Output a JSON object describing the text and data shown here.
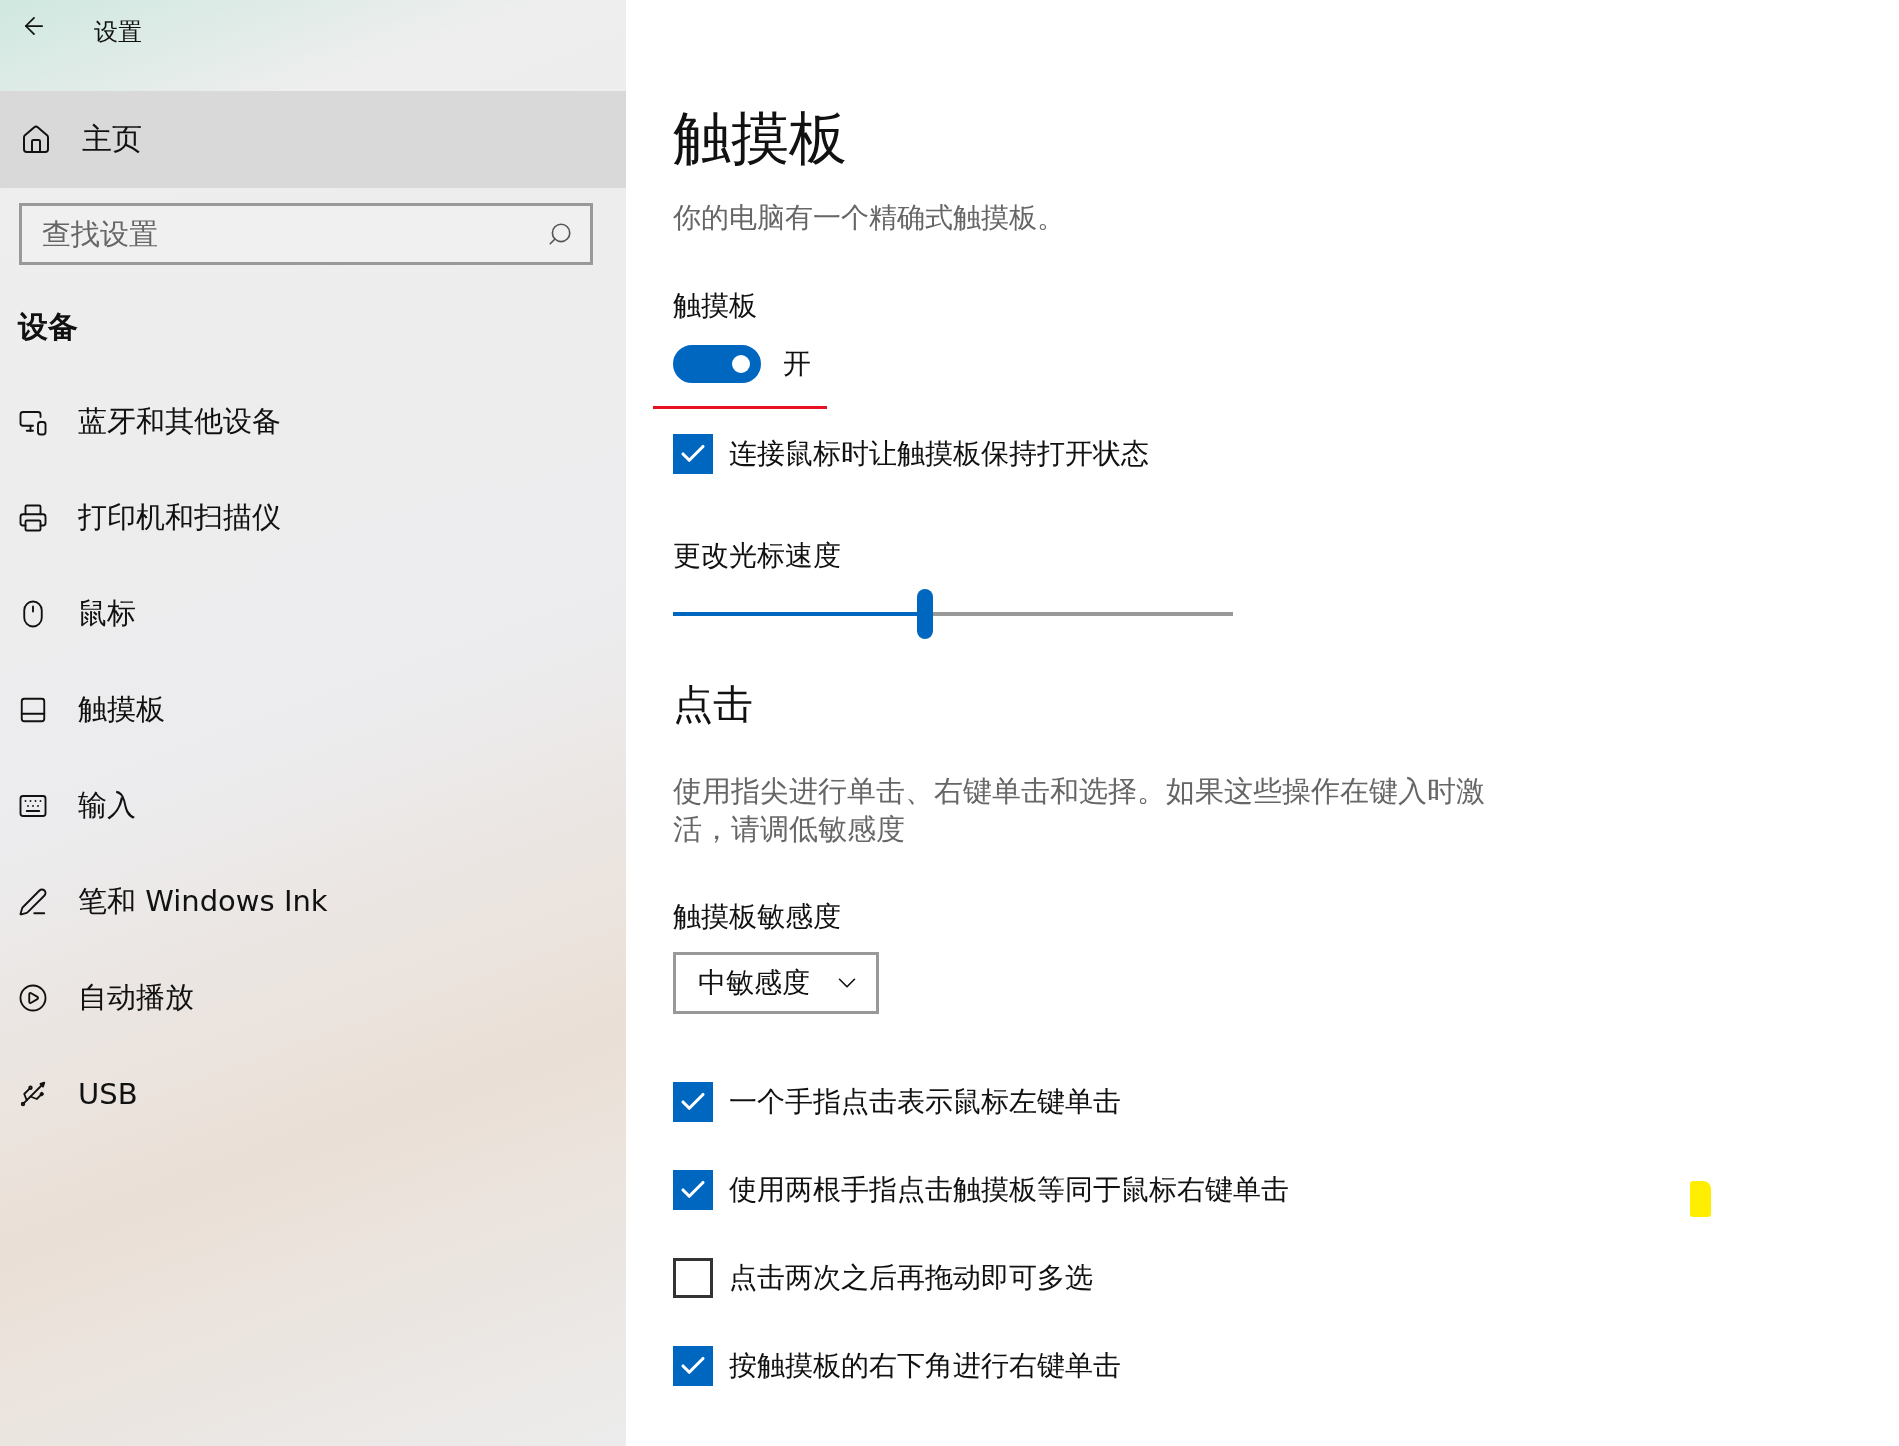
{
  "window": {
    "title": "设置"
  },
  "sidebar": {
    "home": "主页",
    "search": {
      "placeholder": "查找设置"
    },
    "section": "设备",
    "items": [
      {
        "label": "蓝牙和其他设备",
        "kind": "devices"
      },
      {
        "label": "打印机和扫描仪",
        "kind": "printer"
      },
      {
        "label": "鼠标",
        "kind": "mouse"
      },
      {
        "label": "触摸板",
        "kind": "touchpad"
      },
      {
        "label": "输入",
        "kind": "keyboard"
      },
      {
        "label": "笔和 Windows Ink",
        "kind": "pen"
      },
      {
        "label": "自动播放",
        "kind": "autoplay"
      },
      {
        "label": "USB",
        "kind": "usb"
      }
    ]
  },
  "content": {
    "title": "触摸板",
    "description": "你的电脑有一个精确式触摸板。",
    "touchpad": {
      "label": "触摸板",
      "on": true,
      "state_text": "开"
    },
    "keep_on": {
      "label": "连接鼠标时让触摸板保持打开状态",
      "checked": true
    },
    "cursor_speed": {
      "label": "更改光标速度",
      "level": 0.45
    },
    "clicks": {
      "heading": "点击",
      "description": "使用指尖进行单击、右键单击和选择。如果这些操作在键入时激活，请调低敏感度",
      "sensitivity": {
        "label": "触摸板敏感度",
        "value": "中敏感度"
      },
      "options": [
        {
          "label": "一个手指点击表示鼠标左键单击",
          "checked": true
        },
        {
          "label": "使用两根手指点击触摸板等同于鼠标右键单击",
          "checked": true
        },
        {
          "label": "点击两次之后再拖动即可多选",
          "checked": false
        },
        {
          "label": "按触摸板的右下角进行右键单击",
          "checked": true
        }
      ]
    }
  }
}
